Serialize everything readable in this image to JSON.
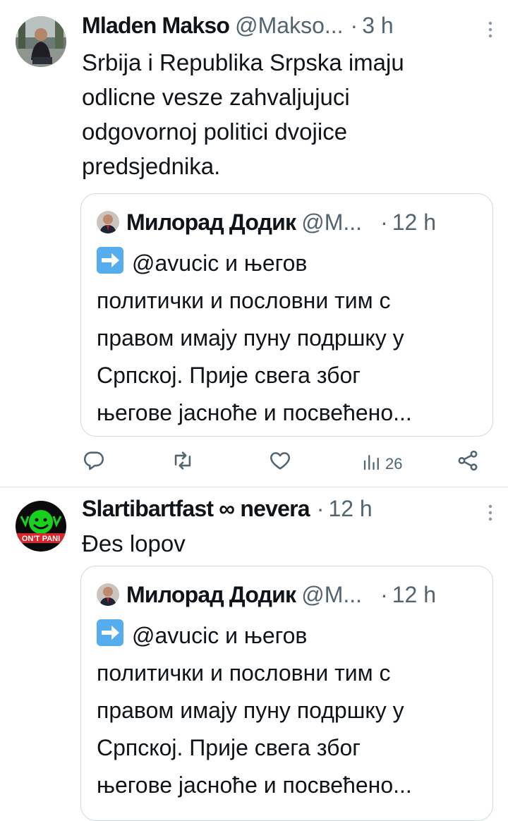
{
  "tweets": [
    {
      "author_name": "Mladen Makso",
      "handle": "@Makso...",
      "separator": "·",
      "time": "3 h",
      "text": "Srbija i Republika Srpska imaju\nodlicne vesze zahvaljujuci\nodgovornoj politici dvojice\npredsjednika.",
      "quote": {
        "author_name": "Милорад Додик",
        "handle": "@М...",
        "separator": "·",
        "time": "12 h",
        "emoji": "right-arrow-emoji",
        "text_lines": [
          "@avucic и његов",
          "политички и пословни тим с",
          "правом имају пуну подршку у",
          "Српској. Прије свега због",
          "његове јасноће и посвећено..."
        ]
      },
      "actions": {
        "reply_icon": "reply-icon",
        "retweet_icon": "retweet-icon",
        "like_icon": "heart-icon",
        "views_icon": "views-icon",
        "views_count": "26",
        "share_icon": "share-icon"
      }
    },
    {
      "author_name": "Slartibartfast ∞ nevera",
      "separator": "·",
      "time": "12 h",
      "text": "Đes lopov",
      "avatar_text": "ON'T PANI",
      "quote": {
        "author_name": "Милорад Додик",
        "handle": "@М...",
        "separator": "·",
        "time": "12 h",
        "emoji": "right-arrow-emoji",
        "text_lines": [
          "@avucic и његов",
          "политички и пословни тим с",
          "правом имају пуну подршку у",
          "Српској. Прије свега због",
          "његове јасноће и посвећено..."
        ]
      }
    }
  ],
  "colors": {
    "text": "#0f1419",
    "secondary": "#536471",
    "border": "#cfd9de",
    "emoji_blue": "#55acee",
    "avatar2_green": "#18d11d"
  }
}
